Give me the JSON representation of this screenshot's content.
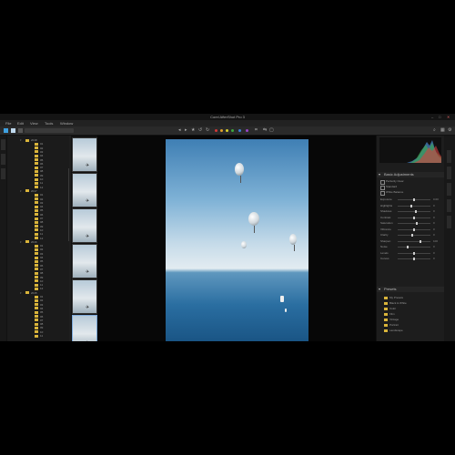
{
  "app": {
    "title": "Corel AfterShot Pro 3"
  },
  "window_controls": [
    "–",
    "□",
    "✕"
  ],
  "menu": [
    "File",
    "Edit",
    "View",
    "Tools",
    "Window"
  ],
  "toolbar": {
    "view_buttons": [
      "grid-view",
      "single-view"
    ],
    "color_dots": [
      "#d33838",
      "#e2a12a",
      "#d9d12c",
      "#3daa3d",
      "#3d7fd6",
      "#9a45c9"
    ],
    "icons": [
      "undo-icon",
      "redo-icon",
      "star-icon",
      "rotate-left-icon",
      "rotate-right-icon",
      "crop-icon",
      "zoom-icon",
      "fit-icon",
      "compare-icon"
    ]
  },
  "folders": {
    "items": [
      "2018",
      "01",
      "02",
      "03",
      "04",
      "05",
      "06",
      "07",
      "08",
      "09",
      "10",
      "11",
      "12",
      "2017",
      "01",
      "02",
      "03",
      "04",
      "05",
      "06",
      "07",
      "08",
      "09",
      "10",
      "11",
      "12",
      "2016",
      "01",
      "02",
      "03",
      "04",
      "05",
      "06",
      "07",
      "08",
      "09",
      "10",
      "11",
      "12",
      "2015",
      "01",
      "02",
      "03",
      "04",
      "05",
      "06",
      "07",
      "08",
      "09",
      "10",
      "11"
    ]
  },
  "thumbnails": {
    "count": 6,
    "selected_index": 5
  },
  "right_panel": {
    "section_basic": "Basic Adjustments",
    "checkbox_labels": [
      "Perfectly Clear",
      "Standard",
      "White Balance"
    ],
    "adjustments": [
      {
        "label": "Exposure",
        "value": "0.00",
        "pos": 0.5
      },
      {
        "label": "Highlights",
        "value": "0",
        "pos": 0.4
      },
      {
        "label": "Shadows",
        "value": "0",
        "pos": 0.55
      },
      {
        "label": "Contrast",
        "value": "0",
        "pos": 0.5
      },
      {
        "label": "Saturation",
        "value": "0",
        "pos": 0.6
      },
      {
        "label": "Vibrance",
        "value": "0",
        "pos": 0.5
      },
      {
        "label": "Clarity",
        "value": "0",
        "pos": 0.45
      },
      {
        "label": "Sharpen",
        "value": "100",
        "pos": 0.7
      },
      {
        "label": "Noise",
        "value": "0",
        "pos": 0.3
      },
      {
        "label": "Levels",
        "value": "0",
        "pos": 0.5
      },
      {
        "label": "Curves",
        "value": "0",
        "pos": 0.5
      }
    ],
    "section_presets": "Presets",
    "preset_items": [
      "My Presets",
      "Black & White",
      "Color",
      "Film",
      "Vintage",
      "Portrait",
      "Landscape"
    ]
  }
}
